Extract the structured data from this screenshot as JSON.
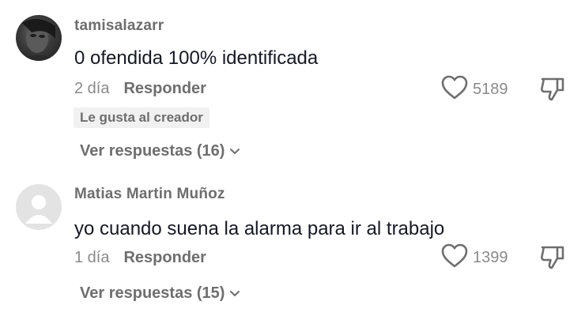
{
  "comments": [
    {
      "username": "tamisalazarr",
      "text": "0 ofendida 100% identificada",
      "time": "2 día",
      "reply_label": "Responder",
      "likes": "5189",
      "creator_badge": "Le gusta al creador",
      "view_replies": "Ver respuestas (16)",
      "avatar": "user-photo"
    },
    {
      "username": "Matias Martin Muñoz",
      "text": "yo cuando suena la alarma para ir al trabajo",
      "time": "1 día",
      "reply_label": "Responder",
      "likes": "1399",
      "view_replies": "Ver respuestas (15)",
      "avatar": "default-avatar"
    }
  ],
  "icons": {
    "like": "heart-outline-icon",
    "dislike": "thumbs-down-outline-icon",
    "expand": "chevron-down-icon"
  },
  "colors": {
    "text_primary": "#161823",
    "text_secondary": "#8a8a8a",
    "badge_bg": "#f1f1f2"
  }
}
